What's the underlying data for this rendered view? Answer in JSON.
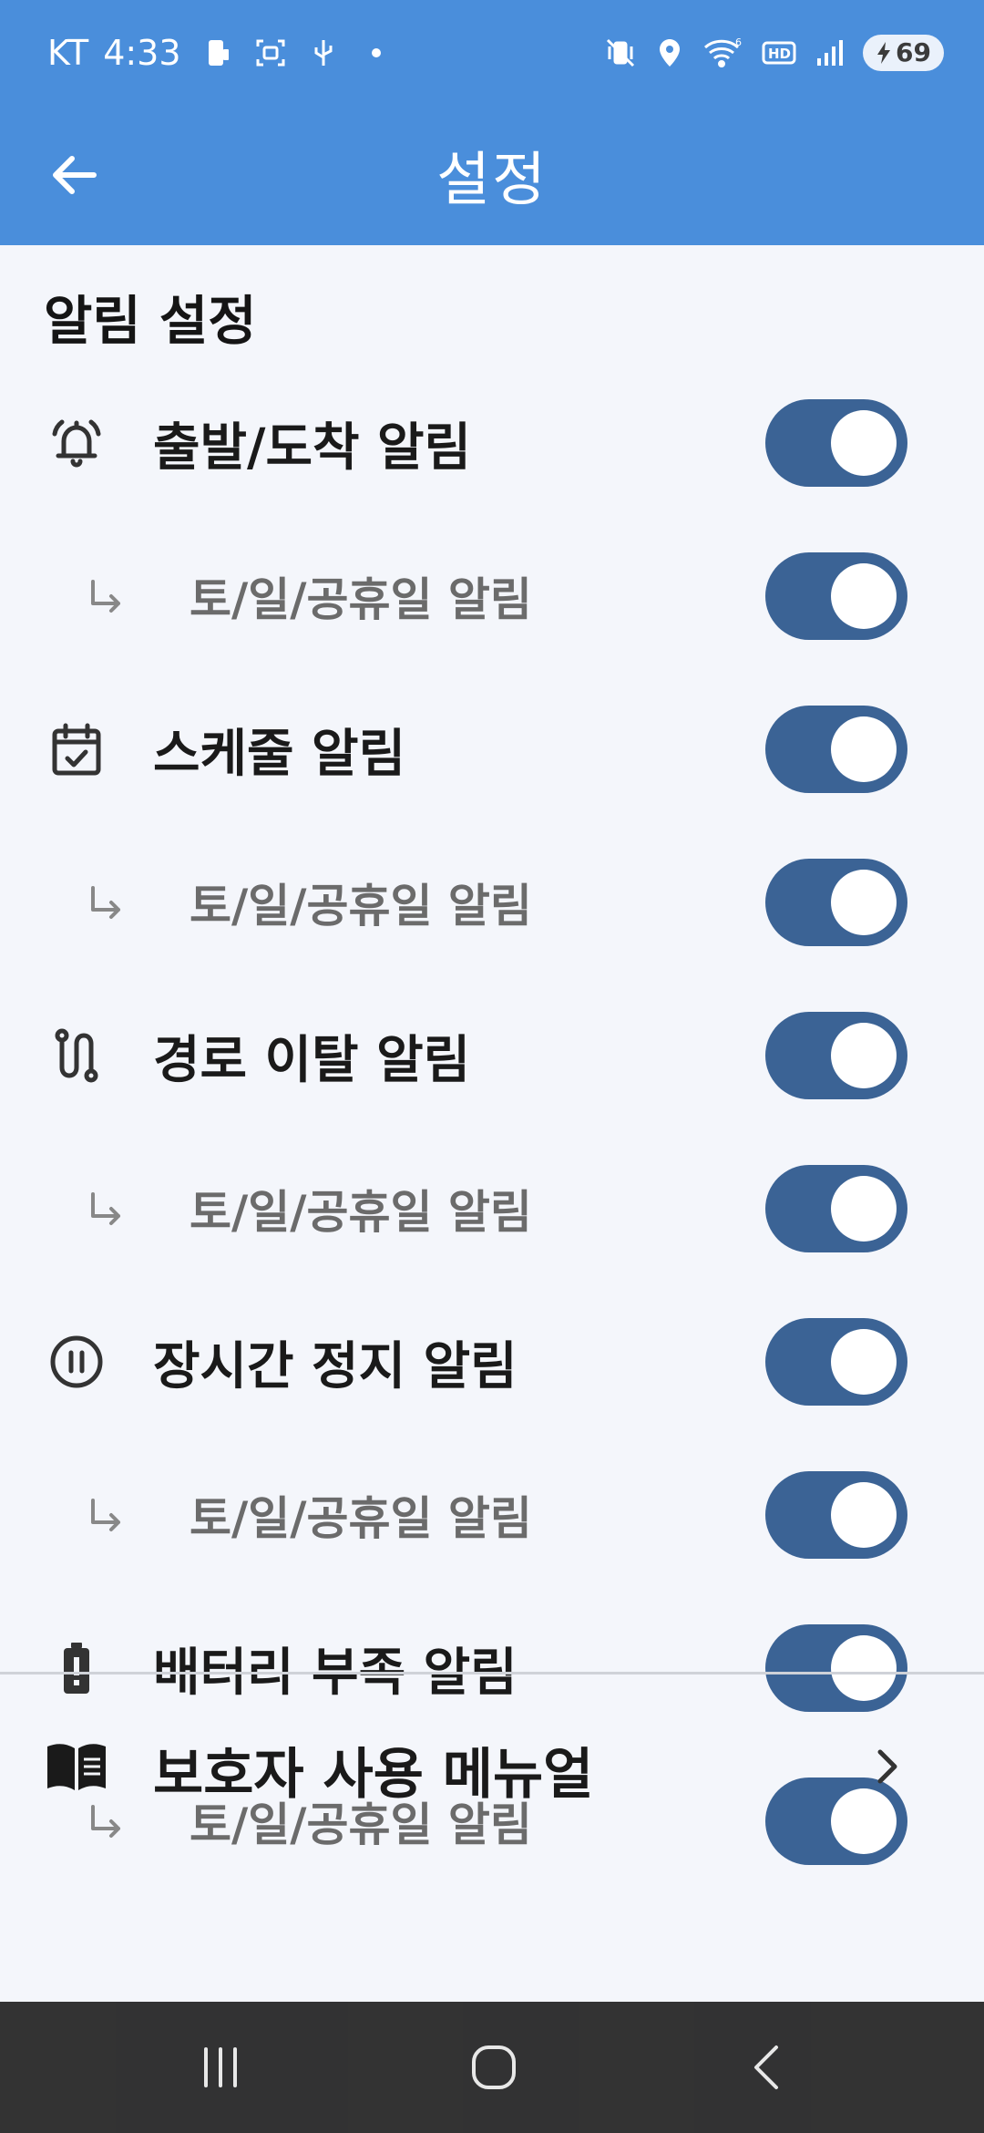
{
  "status_bar": {
    "carrier": "KT",
    "time": "4:33",
    "battery_level": "69",
    "icons_left": [
      "phone-screen-icon",
      "screenshot-icon",
      "usb-icon",
      "dot-icon"
    ],
    "icons_right": [
      "mute-vibrate-icon",
      "location-icon",
      "wifi-6-icon",
      "hd-icon",
      "signal-icon",
      "battery-charging-icon"
    ]
  },
  "app_bar": {
    "title": "설정",
    "back_icon": "arrow-left-icon",
    "background": "#4a8edb"
  },
  "notifications": {
    "section_title": "알림 설정",
    "items": [
      {
        "label": "출발/도착 알림",
        "icon": "bell-ringing-icon",
        "enabled": true,
        "sub": {
          "label": "토/일/공휴일 알림",
          "icon": "sub-arrow-icon",
          "enabled": true
        }
      },
      {
        "label": "스케줄 알림",
        "icon": "calendar-check-icon",
        "enabled": true,
        "sub": {
          "label": "토/일/공휴일 알림",
          "icon": "sub-arrow-icon",
          "enabled": true
        }
      },
      {
        "label": "경로 이탈 알림",
        "icon": "route-icon",
        "enabled": true,
        "sub": {
          "label": "토/일/공휴일 알림",
          "icon": "sub-arrow-icon",
          "enabled": true
        }
      },
      {
        "label": "장시간 정지 알림",
        "icon": "pause-circle-icon",
        "enabled": true,
        "sub": {
          "label": "토/일/공휴일 알림",
          "icon": "sub-arrow-icon",
          "enabled": true
        }
      },
      {
        "label": "배터리 부족 알림",
        "icon": "battery-alert-icon",
        "enabled": true,
        "sub": {
          "label": "토/일/공휴일 알림",
          "icon": "sub-arrow-icon",
          "enabled": true
        }
      }
    ]
  },
  "manual": {
    "label": "보호자 사용 메뉴얼",
    "icon": "book-open-icon"
  },
  "nav_bar": {
    "buttons": [
      "recent-apps-icon",
      "home-icon",
      "back-icon"
    ]
  },
  "colors": {
    "accent": "#4a8edb",
    "toggle_on": "#3b6395",
    "background": "#f4f6fb"
  }
}
